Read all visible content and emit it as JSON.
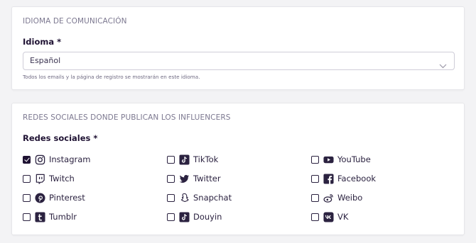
{
  "language_section": {
    "title": "IDIOMA DE COMUNICACIÓN",
    "label": "Idioma *",
    "selected_value": "Español",
    "helper_text": "Todos los emails y la página de registro se mostrarán en este idioma."
  },
  "social_section": {
    "title": "REDES SOCIALES DONDE PUBLICAN LOS INFLUENCERS",
    "label": "Redes sociales *",
    "options": [
      {
        "label": "Instagram",
        "icon": "instagram-icon",
        "checked": true
      },
      {
        "label": "TikTok",
        "icon": "tiktok-icon",
        "checked": false
      },
      {
        "label": "YouTube",
        "icon": "youtube-icon",
        "checked": false
      },
      {
        "label": "Twitch",
        "icon": "twitch-icon",
        "checked": false
      },
      {
        "label": "Twitter",
        "icon": "twitter-icon",
        "checked": false
      },
      {
        "label": "Facebook",
        "icon": "facebook-icon",
        "checked": false
      },
      {
        "label": "Pinterest",
        "icon": "pinterest-icon",
        "checked": false
      },
      {
        "label": "Snapchat",
        "icon": "snapchat-icon",
        "checked": false
      },
      {
        "label": "Weibo",
        "icon": "weibo-icon",
        "checked": false
      },
      {
        "label": "Tumblr",
        "icon": "tumblr-icon",
        "checked": false
      },
      {
        "label": "Douyin",
        "icon": "douyin-icon",
        "checked": false
      },
      {
        "label": "VK",
        "icon": "vk-icon",
        "checked": false
      }
    ]
  },
  "colors": {
    "background": "#f3f3f5",
    "card": "#ffffff",
    "text_dark": "#1f1233",
    "text_muted": "#7c7890",
    "twitter_blue": "#1f1233"
  }
}
